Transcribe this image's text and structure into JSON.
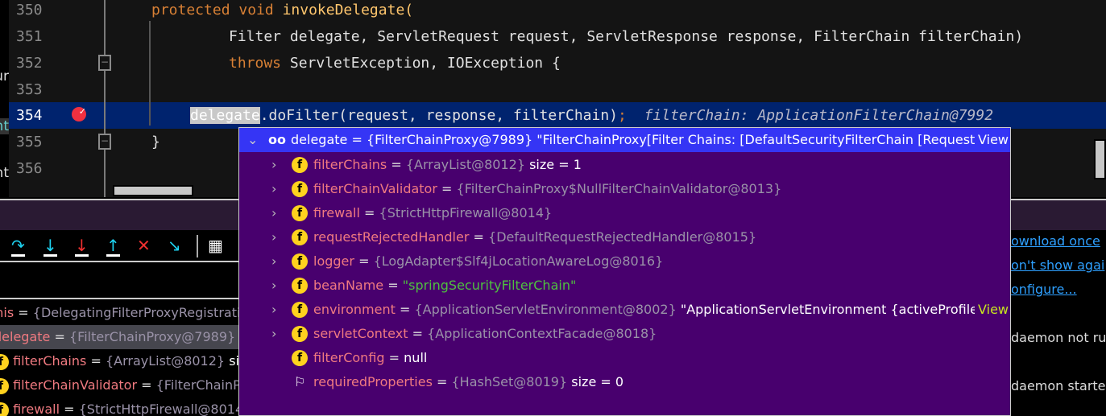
{
  "editor": {
    "lines": [
      {
        "num": "350",
        "kw": "protected void ",
        "text": "invokeDelegate("
      },
      {
        "num": "351",
        "text": "Filter delegate, ServletRequest request, ServletResponse response, FilterChain filterChain)"
      },
      {
        "num": "352",
        "kw": "throws ",
        "text": "ServletException, IOException {"
      },
      {
        "num": "353",
        "text": ""
      },
      {
        "num": "354",
        "sel": "delegate",
        "text": ".doFilter(request, response, filterChain)",
        "semi": ";",
        "hint": "filterChain: ApplicationFilterChain@7992"
      },
      {
        "num": "355",
        "text": "}"
      },
      {
        "num": "356",
        "text": ""
      }
    ],
    "left_fragments": [
      "ur",
      "nt",
      "nt"
    ]
  },
  "popup": {
    "header": {
      "name": "delegate",
      "value": "{FilterChainProxy@7989}",
      "string": "\"FilterChainProxy[Filter Chains: [DefaultSecurityFilterChain [RequestMa",
      "ellipsis": "...",
      "view": "View"
    },
    "rows": [
      {
        "name": "filterChains",
        "value": "{ArrayList@8012}",
        "extra": "size = 1",
        "expand": true,
        "icon": "f"
      },
      {
        "name": "filterChainValidator",
        "value": "{FilterChainProxy$NullFilterChainValidator@8013}",
        "expand": true,
        "icon": "f"
      },
      {
        "name": "firewall",
        "value": "{StrictHttpFirewall@8014}",
        "expand": true,
        "icon": "f"
      },
      {
        "name": "requestRejectedHandler",
        "value": "{DefaultRequestRejectedHandler@8015}",
        "expand": true,
        "icon": "f"
      },
      {
        "name": "logger",
        "value": "{LogAdapter$Slf4jLocationAwareLog@8016}",
        "expand": true,
        "icon": "f"
      },
      {
        "name": "beanName",
        "string": "\"springSecurityFilterChain\"",
        "expand": true,
        "icon": "f"
      },
      {
        "name": "environment",
        "value": "{ApplicationServletEnvironment@8002}",
        "extra": "\"ApplicationServletEnvironment {activeProfiles=",
        "ellipsis": "...",
        "view": "View",
        "expand": true,
        "icon": "f"
      },
      {
        "name": "servletContext",
        "value": "{ApplicationContextFacade@8018}",
        "expand": true,
        "icon": "f"
      },
      {
        "name": "filterConfig",
        "extra": "null",
        "expand": false,
        "icon": "f"
      },
      {
        "name": "requiredProperties",
        "value": "{HashSet@8019}",
        "extra": "size = 0",
        "expand": false,
        "icon": "flag"
      }
    ]
  },
  "variables": [
    {
      "name": "this",
      "value": "{DelegatingFilterProxyRegistratio"
    },
    {
      "name": "delegate",
      "value": "{FilterChainProxy@7989}",
      "extra": "\"F"
    },
    {
      "name": "filterChains",
      "value": "{ArrayList@8012}",
      "extra": "size"
    },
    {
      "name": "filterChainValidator",
      "value": "{FilterChainPro"
    },
    {
      "name": "firewall",
      "value": "{StrictHttpFirewall@8014}"
    }
  ],
  "right_panel": {
    "links": [
      "ownload once",
      "on't show agai",
      "onfigure..."
    ],
    "messages": [
      "daemon not ru",
      "daemon starte"
    ]
  },
  "toolbar": [
    "step-over",
    "step-into",
    "force-step-into",
    "step-out",
    "drop-frame",
    "run-to-cursor",
    "evaluate"
  ],
  "colors": {
    "popup_bg": "#48006e",
    "popup_header": "#3535f5",
    "current_line": "#00236e",
    "link": "#2ea0ff"
  }
}
